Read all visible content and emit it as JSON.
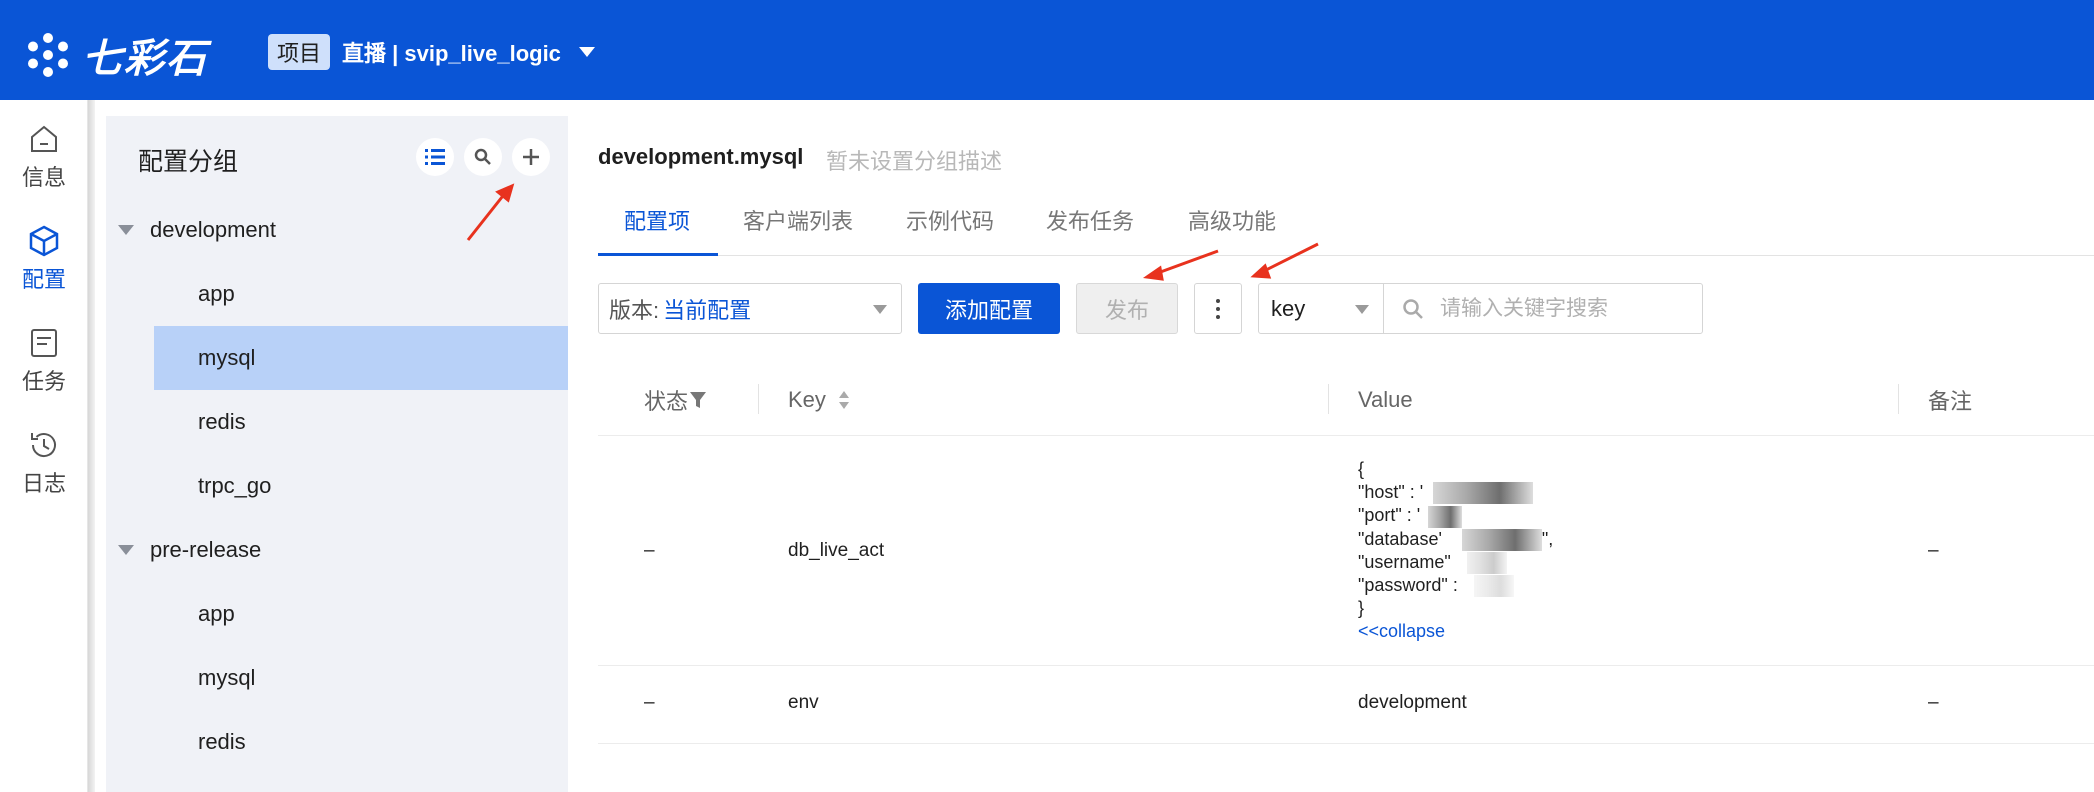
{
  "header": {
    "logo_text": "七彩石",
    "project_tag": "项目",
    "project_name": "直播 | svip_live_logic"
  },
  "rail": {
    "items": [
      {
        "label": "信息",
        "icon": "home-icon"
      },
      {
        "label": "配置",
        "icon": "cube-icon"
      },
      {
        "label": "任务",
        "icon": "task-icon"
      },
      {
        "label": "日志",
        "icon": "history-icon"
      }
    ]
  },
  "groups": {
    "title": "配置分组",
    "tree": [
      {
        "label": "development",
        "children": [
          "app",
          "mysql",
          "redis",
          "trpc_go"
        ]
      },
      {
        "label": "pre-release",
        "children": [
          "app",
          "mysql",
          "redis"
        ]
      }
    ],
    "selected": "development.mysql"
  },
  "main": {
    "title": "development.mysql",
    "description": "暂未设置分组描述",
    "tabs": [
      "配置项",
      "客户端列表",
      "示例代码",
      "发布任务",
      "高级功能"
    ],
    "toolbar": {
      "version_prefix": "版本:",
      "version_value": "当前配置",
      "add_label": "添加配置",
      "publish_label": "发布",
      "key_select": "key",
      "search_placeholder": "请输入关键字搜索"
    },
    "table": {
      "headers": [
        "状态",
        "Key",
        "Value",
        "备注"
      ],
      "rows": [
        {
          "status": "–",
          "key": "db_live_act",
          "value_lines": [
            "{",
            "\"host\" : '",
            "\"port\" : '",
            "\"database'",
            "\"username\"",
            "\"password\" :",
            "}"
          ],
          "value_line_suffixes": [
            "",
            "",
            "",
            "\",",
            "",
            "",
            ""
          ],
          "collapse_label": "<<collapse",
          "note": "–"
        },
        {
          "status": "–",
          "key": "env",
          "value": "development",
          "note": "–"
        }
      ]
    }
  },
  "colors": {
    "brand_blue": "#0a55d6",
    "selected_row": "#b8d1f8",
    "annotation_red": "#e8321e"
  }
}
